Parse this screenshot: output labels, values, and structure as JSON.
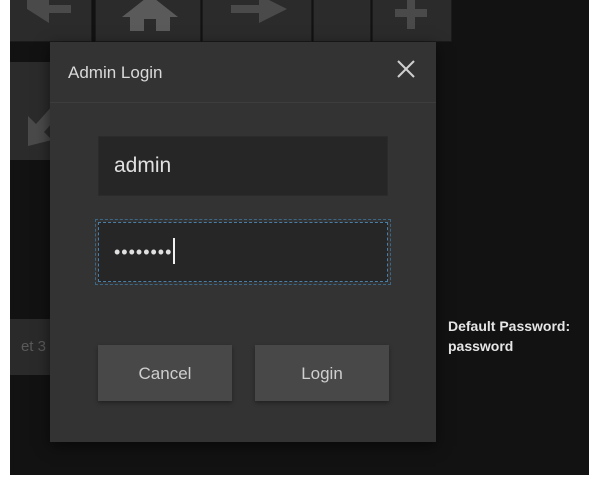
{
  "modal": {
    "title": "Admin Login",
    "username_value": "admin",
    "password_mask": "••••••••",
    "cancel_label": "Cancel",
    "login_label": "Login"
  },
  "background": {
    "preset_label": "et 3",
    "hint_line1": "Default Password:",
    "hint_line2": "password"
  },
  "icons": [
    "left-arrow-icon",
    "home-icon",
    "right-arrow-icon",
    "plus-icon",
    "down-left-arrow-icon",
    "close-icon"
  ],
  "colors": {
    "backdrop": "#121212",
    "modal_bg": "#333333",
    "field_bg": "#262626",
    "button_bg": "#484848",
    "focus_border": "#4a7ea4",
    "hint_text": "#e6e6e6"
  }
}
